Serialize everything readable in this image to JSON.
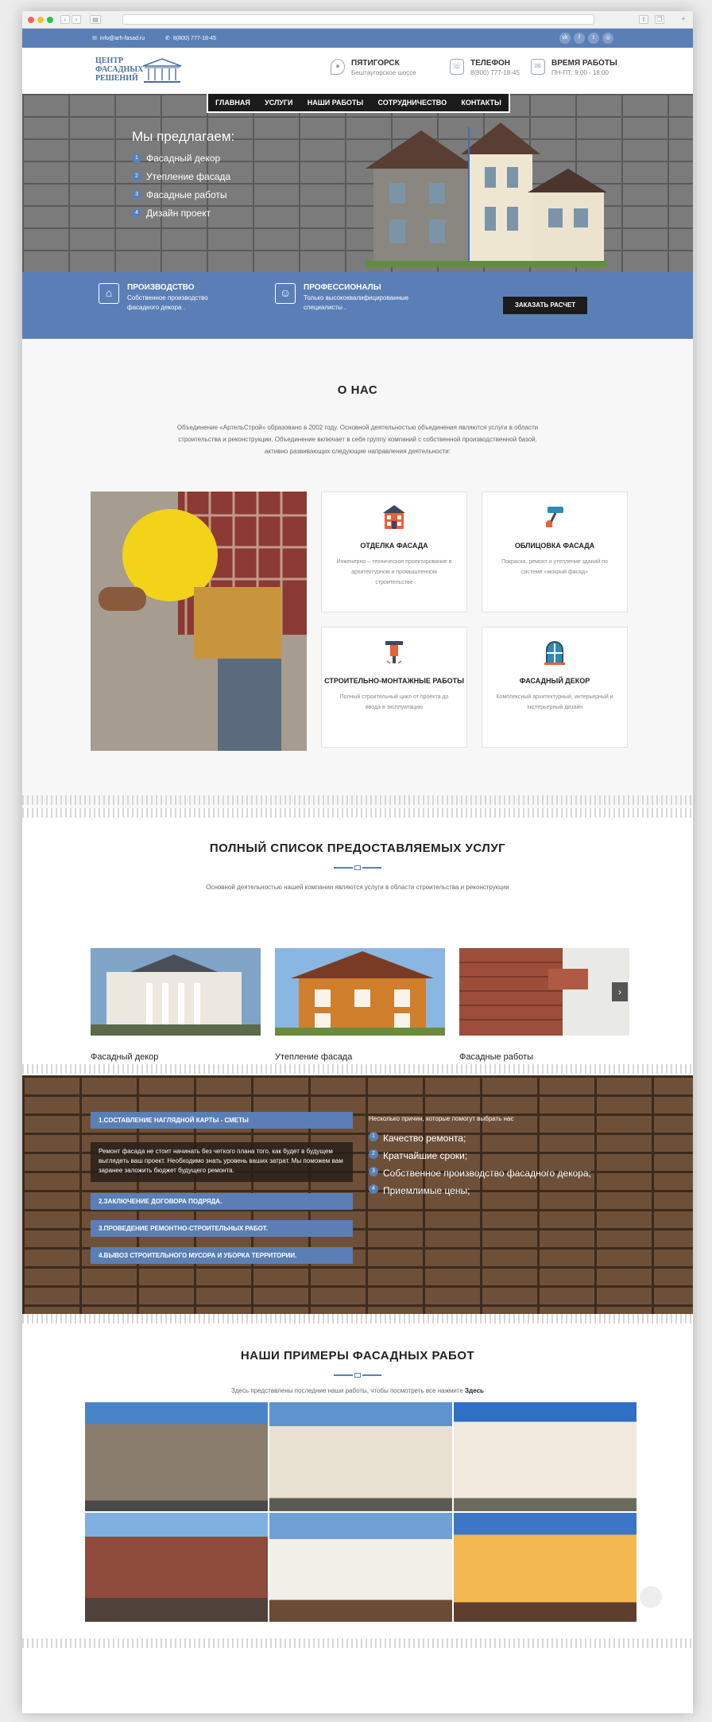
{
  "topbar": {
    "email": "info@arh-fasad.ru",
    "phone": "8(800) 777-18-45",
    "social": [
      "vk",
      "f",
      "tw",
      "ig"
    ]
  },
  "logo": {
    "line1": "ЦЕНТР",
    "line2": "ФАСАДНЫХ",
    "line3": "РЕШЕНИЙ"
  },
  "header": [
    {
      "icon": "location-icon",
      "title": "ПЯТИГОРСК",
      "sub": "Бештаугорское шоссе"
    },
    {
      "icon": "phone-icon",
      "title": "ТЕЛЕФОН",
      "sub": "8(800) 777-18-45"
    },
    {
      "icon": "clock-icon",
      "title": "ВРЕМЯ РАБОТЫ",
      "sub": "ПН-ПТ: 9:00 - 18:00"
    }
  ],
  "nav": [
    "ГЛАВНАЯ",
    "УСЛУГИ",
    "НАШИ РАБОТЫ",
    "СОТРУДНИЧЕСТВО",
    "КОНТАКТЫ"
  ],
  "hero": {
    "title": "Мы предлагаем:",
    "items": [
      "Фасадный декор",
      "Утепление фасада",
      "Фасадные работы",
      "Дизайн проект"
    ]
  },
  "band": {
    "f1_title": "ПРОИЗВОДСТВО",
    "f1_text": "Собственное производство фасадного декора .",
    "f2_title": "ПРОФЕССИОНАЛЫ",
    "f2_text": "Только высококвалифицированные специалисты .",
    "button": "ЗАКАЗАТЬ РАСЧЕТ"
  },
  "about": {
    "title": "О НАС",
    "text": "Объединение «АртельСтрой» образовано в 2002 году. Основной деятельностью объединения являются услуги в области строительства и реконструкции. Объединение включает в себя группу компаний с собственной производственной базой, активно развивающих следующие направления деятельности:",
    "cards": [
      {
        "title": "ОТДЕЛКА ФАСАДА",
        "desc": "Инженерно – техническое проектирование в архитектурном и промышленном строительстве"
      },
      {
        "title": "ОБЛИЦОВКА ФАСАДА",
        "desc": "Покраска, ремонт и утепление зданий по системе «мокрый фасад»"
      },
      {
        "title": "СТРОИТЕЛЬНО-МОНТАЖНЫЕ РАБОТЫ",
        "desc": "Полный строительный цикл от проекта до ввода в эксплуатацию"
      },
      {
        "title": "ФАСАДНЫЙ ДЕКОР",
        "desc": "Комплексный архитектурный, интерьерный и экстерьерный дизайн"
      }
    ]
  },
  "services": {
    "title": "ПОЛНЫЙ СПИСОК ПРЕДОСТАВЛЯЕМЫХ УСЛУГ",
    "text": "Основной деятельностью нашей компании являются услуги в области строительства и реконструкции",
    "items": [
      "Фасадный декор",
      "Утепление фасада",
      "Фасадные работы"
    ]
  },
  "why": {
    "steps": [
      "1.СОСТАВЛЕНИЕ НАГЛЯДНОЙ КАРТЫ - СМЕТЫ",
      "2.ЗАКЛЮЧЕНИЕ ДОГОВОРА ПОДРЯДА.",
      "3.ПРОВЕДЕНИЕ РЕМОНТНО-СТРОИТЕЛЬНЫХ РАБОТ.",
      "4.ВЫВОЗ СТРОИТЕЛЬНОГО МУСОРА И УБОРКА ТЕРРИТОРИИ."
    ],
    "step1_body": "Ремонт фасада не стоит начинать без четкого плана того, как будет в будущем выглядеть ваш проект. Необходимо знать уровень ваших затрат. Мы поможем вам заранее заложить бюджет будущего ремонта.",
    "reasons_title": "Несколько причин, которые помогут выбрать нас",
    "reasons": [
      "Качество ремонта;",
      "Кратчайшие сроки;",
      "Собственное производство фасадного декора;",
      "Приемлимые цены;"
    ]
  },
  "works": {
    "title": "НАШИ ПРИМЕРЫ ФАСАДНЫХ РАБОТ",
    "text": "Здесь представлены последние наши работы, чтобы посмотреть все нажмите",
    "link": "Здесь"
  },
  "colors": {
    "accent": "#5a7fb7",
    "dark": "#1b1b1b"
  }
}
